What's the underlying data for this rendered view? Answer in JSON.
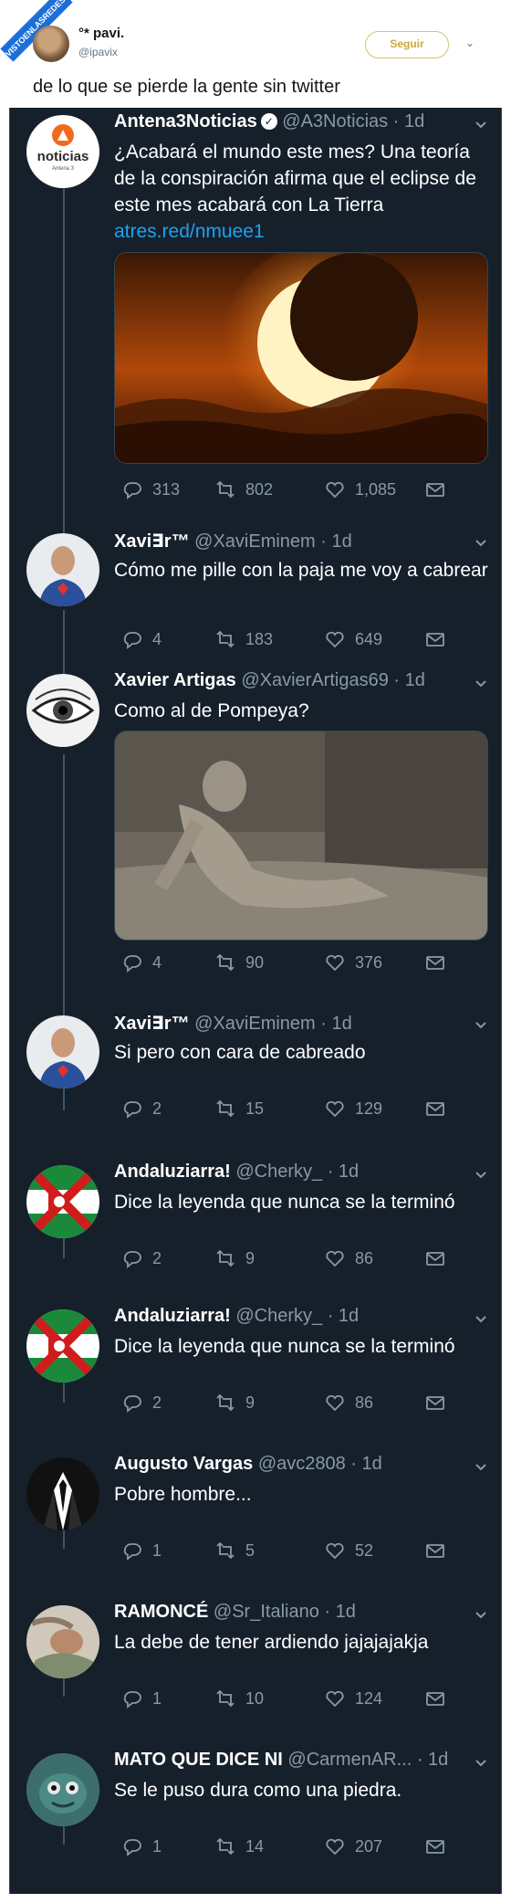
{
  "watermark": "VISTOENLASREDES.com",
  "outer_tweet": {
    "name": "°* pavi.",
    "handle": "@ipavix",
    "follow_label": "Seguir",
    "text": "de lo que se pierde la gente sin twitter"
  },
  "antena_logo": {
    "word": "noticias",
    "sub": "Antena 3"
  },
  "tweets": [
    {
      "name": "Antena3Noticias",
      "handle": "@A3Noticias · 1d",
      "verified": true,
      "text": "¿Acabará el mundo este mes? Una teoría de la conspiración afirma que el eclipse de este mes acabará con La Tierra",
      "link": "atres.red/nmuee1",
      "reply": "313",
      "retweet": "802",
      "like": "1,085"
    },
    {
      "name": "Xavi∃r™",
      "handle": "@XaviEminem · 1d",
      "text": "Cómo me pille con la paja me voy a cabrear",
      "reply": "4",
      "retweet": "183",
      "like": "649"
    },
    {
      "name": "Xavier Artigas",
      "handle": "@XavierArtigas69 · 1d",
      "text": "Como al de Pompeya?",
      "reply": "4",
      "retweet": "90",
      "like": "376"
    },
    {
      "name": "Xavi∃r™",
      "handle": "@XaviEminem · 1d",
      "text": "Si pero con cara de cabreado",
      "reply": "2",
      "retweet": "15",
      "like": "129"
    },
    {
      "name": "Andaluziarra!",
      "handle": "@Cherky_ · 1d",
      "text": "Dice la leyenda que nunca se la terminó",
      "reply": "2",
      "retweet": "9",
      "like": "86"
    },
    {
      "name": "Andaluziarra!",
      "handle": "@Cherky_ · 1d",
      "text": "Dice la leyenda que nunca se la terminó",
      "reply": "2",
      "retweet": "9",
      "like": "86"
    },
    {
      "name": "Augusto Vargas",
      "handle": "@avc2808 · 1d",
      "text": "Pobre hombre...",
      "reply": "1",
      "retweet": "5",
      "like": "52"
    },
    {
      "name": "RAMONCÉ",
      "handle": "@Sr_Italiano · 1d",
      "text": "La debe de tener ardiendo jajajajakja",
      "reply": "1",
      "retweet": "10",
      "like": "124"
    },
    {
      "name": "MATO QUE DICE NI",
      "handle": "@CarmenAR... · 1d",
      "text": "Se le puso dura como una piedra.",
      "reply": "1",
      "retweet": "14",
      "like": "207"
    }
  ],
  "colors": {
    "background": "#15202b",
    "text": "#ffffff",
    "secondary": "#8899a6",
    "link": "#1da1f2",
    "follow": "#c9a93a"
  }
}
